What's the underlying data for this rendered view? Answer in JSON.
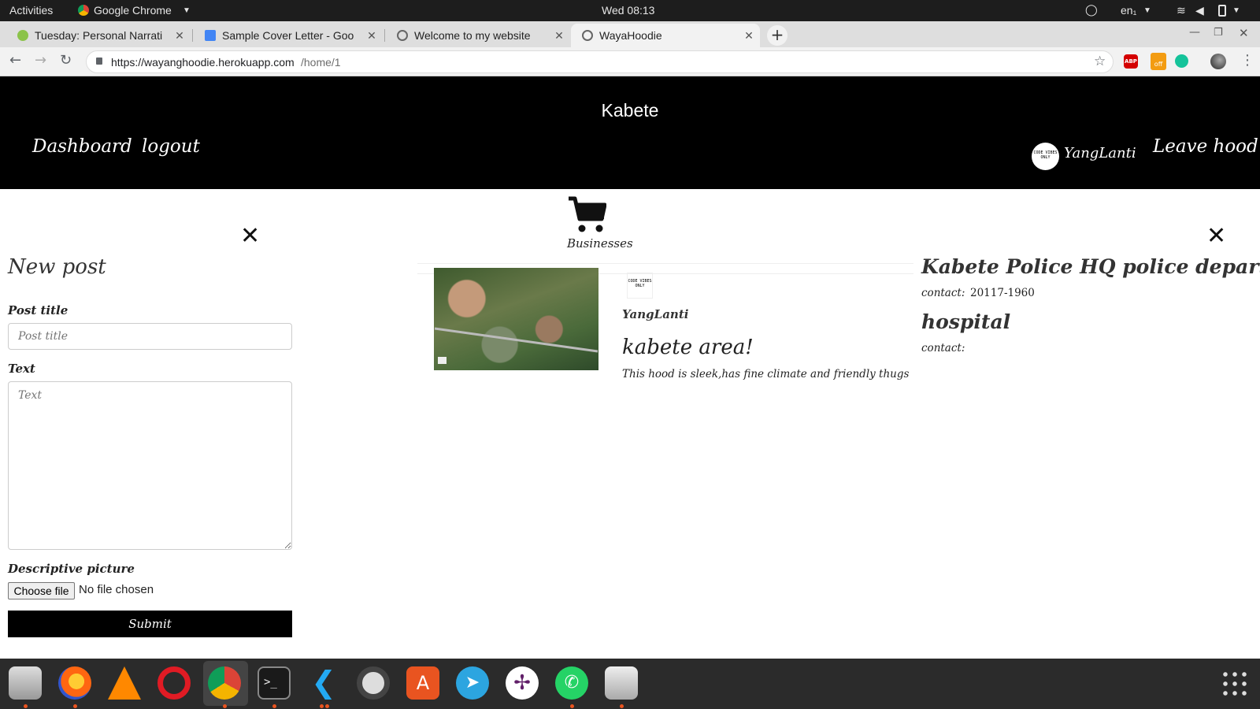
{
  "topbar": {
    "activities": "Activities",
    "app_name": "Google Chrome",
    "clock": "Wed 08:13",
    "lang": "en₁"
  },
  "browser": {
    "tabs": [
      {
        "label": "Tuesday: Personal Narrati",
        "favicon": "plant-icon",
        "active": false
      },
      {
        "label": "Sample Cover Letter - Goo",
        "favicon": "docs-icon",
        "active": false
      },
      {
        "label": "Welcome to my website",
        "favicon": "globe-icon",
        "active": false
      },
      {
        "label": "WayaHoodie",
        "favicon": "globe-icon",
        "active": true
      }
    ],
    "url_host": "https://wayanghoodie.herokuapp.com",
    "url_path": "/home/1",
    "extensions": [
      "ABP",
      "off"
    ]
  },
  "header": {
    "hood_name": "Kabete",
    "nav_dashboard": "Dashboard",
    "nav_logout": "logout",
    "username": "YangLanti",
    "leave": "Leave hood",
    "avatar_text": "CODE VIBES ONLY"
  },
  "new_post": {
    "title": "New post",
    "post_title_label": "Post title",
    "post_title_placeholder": "Post title",
    "text_label": "Text",
    "text_placeholder": "Text",
    "picture_label": "Descriptive picture",
    "choose_file": "Choose file",
    "no_file": "No file chosen",
    "submit": "Submit"
  },
  "businesses": {
    "label": "Businesses"
  },
  "hood_post": {
    "author": "YangLanti",
    "title": "kabete area!",
    "body": "This hood is sleek,has fine climate and friendly thugs",
    "avatar_text": "CODE VIBES ONLY"
  },
  "departments": [
    {
      "name": "Kabete Police HQ police department",
      "contact_label": "contact:",
      "contact": "20117-1960"
    },
    {
      "name": "hospital",
      "contact_label": "contact:",
      "contact": ""
    }
  ],
  "colors": {
    "header_bg": "#000000",
    "submit_bg": "#000000",
    "ubuntu_orange": "#e95420"
  }
}
